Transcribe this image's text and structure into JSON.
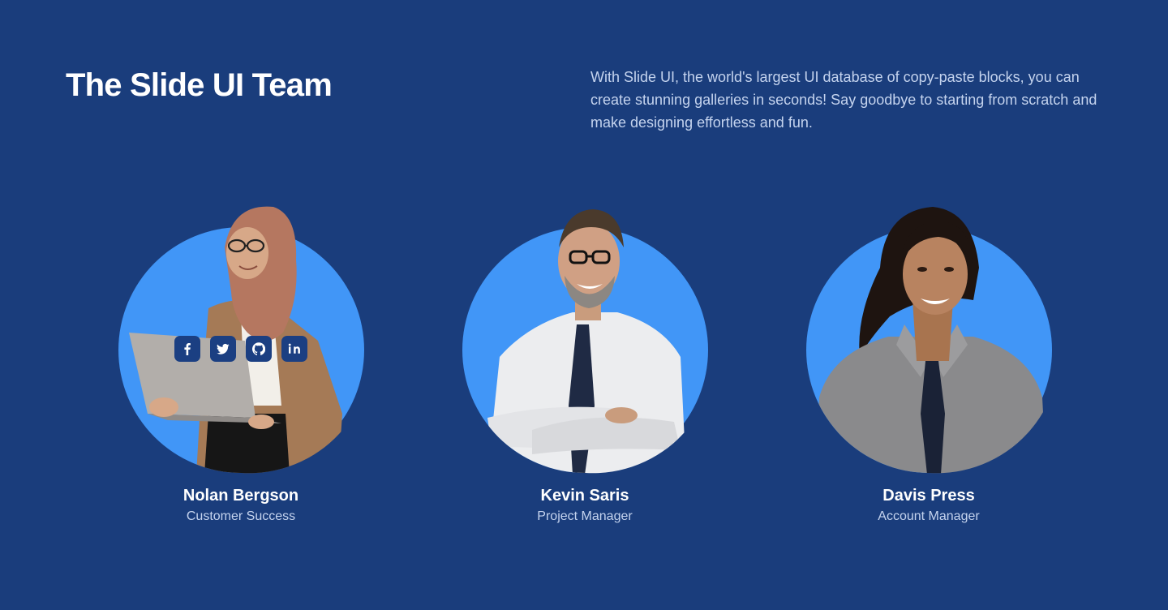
{
  "header": {
    "title": "The Slide UI Team",
    "description": "With Slide UI, the world's largest UI database of copy-paste blocks, you can create stunning galleries in seconds! Say goodbye to starting from scratch and make designing effortless and fun."
  },
  "colors": {
    "background": "#1a3d7c",
    "circle": "#4196f7",
    "social_button": "#1b3f82",
    "text_primary": "#ffffff",
    "text_secondary": "#c4d3ee"
  },
  "team": [
    {
      "name": "Nolan Bergson",
      "role": "Customer Success",
      "socials": [
        "facebook-icon",
        "twitter-icon",
        "github-icon",
        "linkedin-icon"
      ]
    },
    {
      "name": "Kevin Saris",
      "role": "Project Manager"
    },
    {
      "name": "Davis Press",
      "role": "Account Manager"
    }
  ]
}
